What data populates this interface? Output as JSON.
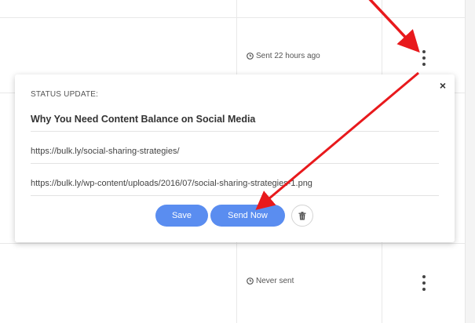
{
  "rows": [
    {
      "status_text": "Sent 22 hours ago"
    },
    {
      "status_text": "Never sent"
    }
  ],
  "popup": {
    "label": "STATUS UPDATE:",
    "title": "Why You Need Content Balance on Social Media",
    "link_url": "https://bulk.ly/social-sharing-strategies/",
    "image_url": "https://bulk.ly/wp-content/uploads/2016/07/social-sharing-strategies-1.png",
    "close_label": "×",
    "save_label": "Save",
    "send_now_label": "Send Now"
  },
  "icons": {
    "clock": "clock-icon",
    "kebab": "more-options-icon",
    "trash": "trash-icon",
    "close": "close-icon"
  },
  "colors": {
    "button": "#5a8df0",
    "arrow": "#e8191c"
  }
}
